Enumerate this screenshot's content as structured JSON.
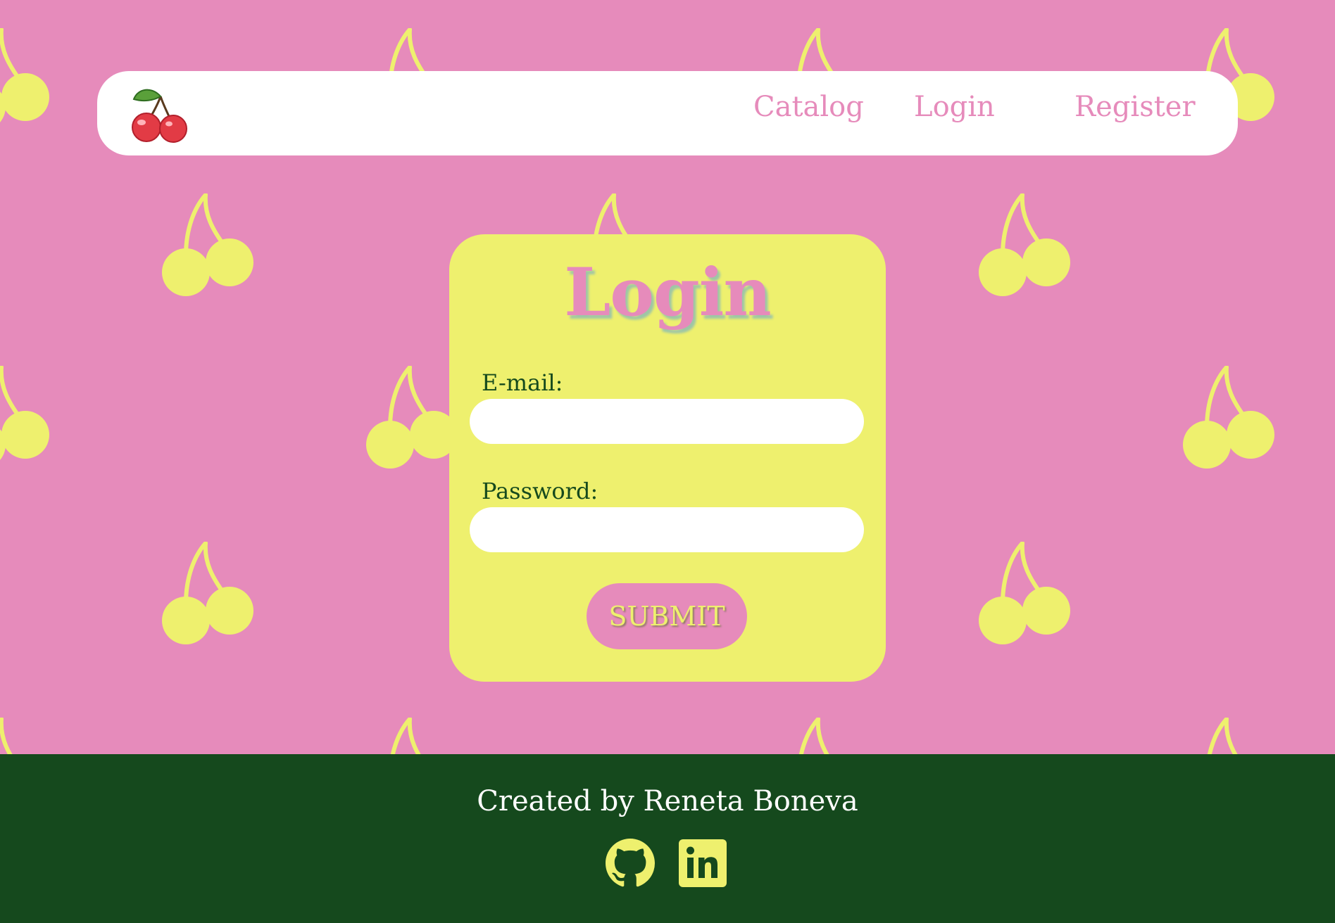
{
  "colors": {
    "background": "#e68bbb",
    "cherry": "#eef06e",
    "card": "#eef06e",
    "footer": "#15491d",
    "label": "#164a1d",
    "accent_pink": "#e68bbb"
  },
  "navbar": {
    "logo_icon": "cherry-icon",
    "links": [
      {
        "label": "Catalog"
      },
      {
        "label": "Login"
      },
      {
        "label": "Register"
      }
    ]
  },
  "login_form": {
    "title": "Login",
    "email_label": "E-mail:",
    "email_value": "",
    "password_label": "Password:",
    "password_value": "",
    "submit_label": "SUBMIT"
  },
  "footer": {
    "credit": "Created by Reneta Boneva",
    "icons": [
      "github-icon",
      "linkedin-icon"
    ]
  }
}
